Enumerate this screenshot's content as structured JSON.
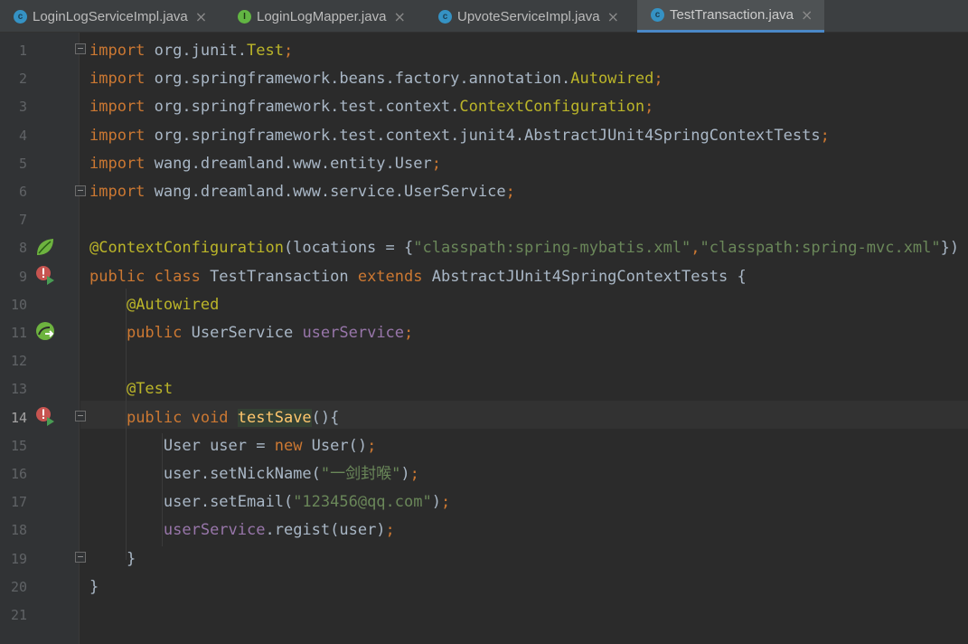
{
  "tabs": [
    {
      "label": "LoginLogServiceImpl.java",
      "icon": "class-c-icon",
      "active": false
    },
    {
      "label": "LoginLogMapper.java",
      "icon": "interface-i-icon",
      "active": false
    },
    {
      "label": "UpvoteServiceImpl.java",
      "icon": "class-c-icon",
      "active": false
    },
    {
      "label": "TestTransaction.java",
      "icon": "class-c-icon",
      "active": true
    }
  ],
  "close_glyph": "×",
  "line_numbers": [
    "1",
    "2",
    "3",
    "4",
    "5",
    "6",
    "7",
    "8",
    "9",
    "10",
    "11",
    "12",
    "13",
    "14",
    "15",
    "16",
    "17",
    "18",
    "19",
    "20",
    "21"
  ],
  "current_line": "14",
  "code_lines": [
    [
      [
        "import ",
        "k"
      ],
      [
        "org.junit.",
        "p"
      ],
      [
        "Test",
        "cls"
      ],
      [
        ";",
        "k"
      ]
    ],
    [
      [
        "import ",
        "k"
      ],
      [
        "org.springframework.beans.factory.annotation.",
        "p"
      ],
      [
        "Autowired",
        "cls"
      ],
      [
        ";",
        "k"
      ]
    ],
    [
      [
        "import ",
        "k"
      ],
      [
        "org.springframework.test.context.",
        "p"
      ],
      [
        "ContextConfiguration",
        "cls"
      ],
      [
        ";",
        "k"
      ]
    ],
    [
      [
        "import ",
        "k"
      ],
      [
        "org.springframework.test.context.junit4.AbstractJUnit4SpringContextTests",
        "p"
      ],
      [
        ";",
        "k"
      ]
    ],
    [
      [
        "import ",
        "k"
      ],
      [
        "wang.dreamland.www.entity.User",
        "p"
      ],
      [
        ";",
        "k"
      ]
    ],
    [
      [
        "import ",
        "k"
      ],
      [
        "wang.dreamland.www.service.UserService",
        "p"
      ],
      [
        ";",
        "k"
      ]
    ],
    [],
    [
      [
        "@ContextConfiguration",
        "ann"
      ],
      [
        "(locations = {",
        "p"
      ],
      [
        "\"classpath:spring-mybatis.xml\"",
        "s"
      ],
      [
        ",",
        "k"
      ],
      [
        "\"classpath:spring-mvc.xml\"",
        "s"
      ],
      [
        "})",
        "p"
      ]
    ],
    [
      [
        "public class ",
        "k"
      ],
      [
        "TestTransaction ",
        "p"
      ],
      [
        "extends ",
        "k"
      ],
      [
        "AbstractJUnit4SpringContextTests {",
        "p"
      ]
    ],
    [
      [
        "    ",
        "p"
      ],
      [
        "@Autowired",
        "ann"
      ]
    ],
    [
      [
        "    ",
        "p"
      ],
      [
        "public ",
        "k"
      ],
      [
        "UserService ",
        "p"
      ],
      [
        "userService",
        "f"
      ],
      [
        ";",
        "k"
      ]
    ],
    [],
    [
      [
        "    ",
        "p"
      ],
      [
        "@Test",
        "ann"
      ]
    ],
    [
      [
        "    ",
        "p"
      ],
      [
        "public void ",
        "k"
      ],
      [
        "testSave",
        "mhl"
      ],
      [
        "(){",
        "p"
      ]
    ],
    [
      [
        "        ",
        "p"
      ],
      [
        "User user = ",
        "p"
      ],
      [
        "new ",
        "k"
      ],
      [
        "User()",
        "p"
      ],
      [
        ";",
        "k"
      ]
    ],
    [
      [
        "        ",
        "p"
      ],
      [
        "user.setNickName(",
        "p"
      ],
      [
        "\"一剑封喉\"",
        "s"
      ],
      [
        ")",
        "p"
      ],
      [
        ";",
        "k"
      ]
    ],
    [
      [
        "        ",
        "p"
      ],
      [
        "user.setEmail(",
        "p"
      ],
      [
        "\"123456@qq.com\"",
        "s"
      ],
      [
        ")",
        "p"
      ],
      [
        ";",
        "k"
      ]
    ],
    [
      [
        "        ",
        "p"
      ],
      [
        "userService",
        "f"
      ],
      [
        ".regist(user)",
        "p"
      ],
      [
        ";",
        "k"
      ]
    ],
    [
      [
        "    ",
        "p"
      ],
      [
        "}",
        "p"
      ]
    ],
    [
      [
        "}",
        "p"
      ]
    ],
    []
  ],
  "gutter_icons": {
    "8": "spring-bean-icon",
    "9": "run-test-class-error-icon",
    "11": "spring-autowired-navigate-icon",
    "14": "run-test-method-error-icon"
  },
  "colors": {
    "background": "#2b2b2b",
    "keyword": "#cc7832",
    "annotation": "#bbb529",
    "string": "#6a8759",
    "field": "#9876aa",
    "method_decl": "#ffc66d",
    "text": "#a9b7c6"
  }
}
